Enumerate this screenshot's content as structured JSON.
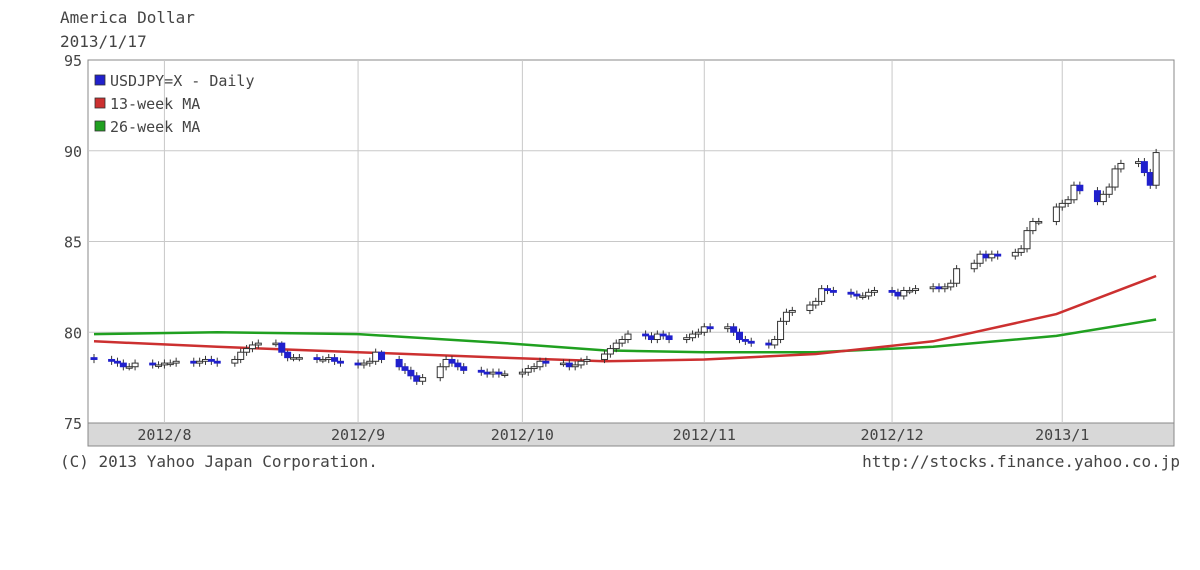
{
  "header": {
    "title": "America Dollar",
    "date": "2013/1/17"
  },
  "footer": {
    "copyright": "(C) 2013 Yahoo Japan Corporation.",
    "url": "http://stocks.finance.yahoo.co.jp"
  },
  "colors": {
    "up_candle": "#ffffff",
    "down_candle": "#2020cc",
    "ma13": "#cc3030",
    "ma26": "#20a020",
    "grid": "#c8c8c8",
    "axis_band": "#d8d8d8"
  },
  "chart_data": {
    "type": "candlestick",
    "title": "America Dollar",
    "subtitle": "2013/1/17",
    "ylim": [
      75,
      95
    ],
    "y_ticks": [
      75,
      80,
      85,
      90,
      95
    ],
    "x_tick_labels": [
      "2012/8",
      "2012/9",
      "2012/10",
      "2012/11",
      "2012/12",
      "2013/1"
    ],
    "x_tick_dates": [
      "2012-08-01",
      "2012-09-03",
      "2012-10-01",
      "2012-11-01",
      "2012-12-03",
      "2013-01-01"
    ],
    "x_range": [
      "2012-07-20",
      "2013-01-18"
    ],
    "grid": true,
    "legend_position": "top-left",
    "legend": [
      {
        "label": "USDJPY=X - Daily",
        "color": "#2020cc"
      },
      {
        "label": "13-week MA",
        "color": "#cc3030"
      },
      {
        "label": "26-week MA",
        "color": "#20a020"
      }
    ],
    "series": [
      {
        "name": "USDJPY=X - Daily",
        "dates": [
          "2012-07-20",
          "2012-07-23",
          "2012-07-24",
          "2012-07-25",
          "2012-07-26",
          "2012-07-27",
          "2012-07-30",
          "2012-07-31",
          "2012-08-01",
          "2012-08-02",
          "2012-08-03",
          "2012-08-06",
          "2012-08-07",
          "2012-08-08",
          "2012-08-09",
          "2012-08-10",
          "2012-08-13",
          "2012-08-14",
          "2012-08-15",
          "2012-08-16",
          "2012-08-17",
          "2012-08-20",
          "2012-08-21",
          "2012-08-22",
          "2012-08-23",
          "2012-08-24",
          "2012-08-27",
          "2012-08-28",
          "2012-08-29",
          "2012-08-30",
          "2012-08-31",
          "2012-09-03",
          "2012-09-04",
          "2012-09-05",
          "2012-09-06",
          "2012-09-07",
          "2012-09-10",
          "2012-09-11",
          "2012-09-12",
          "2012-09-13",
          "2012-09-14",
          "2012-09-17",
          "2012-09-18",
          "2012-09-19",
          "2012-09-20",
          "2012-09-21",
          "2012-09-24",
          "2012-09-25",
          "2012-09-26",
          "2012-09-27",
          "2012-09-28",
          "2012-10-01",
          "2012-10-02",
          "2012-10-03",
          "2012-10-04",
          "2012-10-05",
          "2012-10-08",
          "2012-10-09",
          "2012-10-10",
          "2012-10-11",
          "2012-10-12",
          "2012-10-15",
          "2012-10-16",
          "2012-10-17",
          "2012-10-18",
          "2012-10-19",
          "2012-10-22",
          "2012-10-23",
          "2012-10-24",
          "2012-10-25",
          "2012-10-26",
          "2012-10-29",
          "2012-10-30",
          "2012-10-31",
          "2012-11-01",
          "2012-11-02",
          "2012-11-05",
          "2012-11-06",
          "2012-11-07",
          "2012-11-08",
          "2012-11-09",
          "2012-11-12",
          "2012-11-13",
          "2012-11-14",
          "2012-11-15",
          "2012-11-16",
          "2012-11-19",
          "2012-11-20",
          "2012-11-21",
          "2012-11-22",
          "2012-11-23",
          "2012-11-26",
          "2012-11-27",
          "2012-11-28",
          "2012-11-29",
          "2012-11-30",
          "2012-12-03",
          "2012-12-04",
          "2012-12-05",
          "2012-12-06",
          "2012-12-07",
          "2012-12-10",
          "2012-12-11",
          "2012-12-12",
          "2012-12-13",
          "2012-12-14",
          "2012-12-17",
          "2012-12-18",
          "2012-12-19",
          "2012-12-20",
          "2012-12-21",
          "2012-12-24",
          "2012-12-25",
          "2012-12-26",
          "2012-12-27",
          "2012-12-28",
          "2012-12-31",
          "2013-01-01",
          "2013-01-02",
          "2013-01-03",
          "2013-01-04",
          "2013-01-07",
          "2013-01-08",
          "2013-01-09",
          "2013-01-10",
          "2013-01-11",
          "2013-01-14",
          "2013-01-15",
          "2013-01-16",
          "2013-01-17"
        ],
        "open": [
          78.6,
          78.5,
          78.4,
          78.3,
          78.1,
          78.1,
          78.3,
          78.2,
          78.2,
          78.3,
          78.3,
          78.4,
          78.3,
          78.4,
          78.5,
          78.4,
          78.3,
          78.5,
          78.9,
          79.1,
          79.3,
          79.4,
          79.4,
          78.9,
          78.6,
          78.6,
          78.6,
          78.5,
          78.5,
          78.6,
          78.4,
          78.3,
          78.2,
          78.3,
          78.4,
          78.9,
          78.5,
          78.1,
          77.9,
          77.6,
          77.3,
          77.5,
          78.1,
          78.5,
          78.3,
          78.1,
          77.9,
          77.8,
          77.7,
          77.8,
          77.7,
          77.7,
          77.8,
          78.0,
          78.1,
          78.4,
          78.3,
          78.3,
          78.1,
          78.2,
          78.4,
          78.5,
          78.8,
          79.1,
          79.4,
          79.6,
          79.9,
          79.8,
          79.6,
          79.9,
          79.8,
          79.6,
          79.7,
          79.9,
          80.0,
          80.3,
          80.2,
          80.3,
          80.0,
          79.6,
          79.5,
          79.4,
          79.3,
          79.6,
          80.6,
          81.1,
          81.2,
          81.5,
          81.7,
          82.4,
          82.3,
          82.2,
          82.1,
          82.0,
          82.0,
          82.2,
          82.3,
          82.2,
          82.0,
          82.3,
          82.3,
          82.4,
          82.5,
          82.4,
          82.5,
          82.7,
          83.5,
          83.8,
          84.3,
          84.1,
          84.3,
          84.2,
          84.4,
          84.6,
          85.6,
          86.1,
          86.1,
          86.9,
          87.1,
          87.3,
          88.1,
          87.8,
          87.2,
          87.6,
          88.0,
          89.0,
          89.3,
          89.4,
          88.8,
          88.1
        ],
        "close": [
          78.5,
          78.4,
          78.3,
          78.1,
          78.1,
          78.3,
          78.2,
          78.2,
          78.3,
          78.3,
          78.4,
          78.3,
          78.4,
          78.5,
          78.4,
          78.3,
          78.5,
          78.9,
          79.1,
          79.3,
          79.4,
          79.4,
          78.9,
          78.6,
          78.6,
          78.6,
          78.5,
          78.5,
          78.6,
          78.4,
          78.3,
          78.2,
          78.3,
          78.4,
          78.9,
          78.5,
          78.1,
          77.9,
          77.6,
          77.3,
          77.5,
          78.1,
          78.5,
          78.3,
          78.1,
          77.9,
          77.8,
          77.7,
          77.8,
          77.7,
          77.7,
          77.8,
          78.0,
          78.1,
          78.4,
          78.3,
          78.3,
          78.1,
          78.2,
          78.4,
          78.5,
          78.8,
          79.1,
          79.4,
          79.6,
          79.9,
          79.8,
          79.6,
          79.9,
          79.8,
          79.6,
          79.7,
          79.9,
          80.0,
          80.3,
          80.2,
          80.3,
          80.0,
          79.6,
          79.5,
          79.4,
          79.3,
          79.6,
          80.6,
          81.1,
          81.2,
          81.5,
          81.7,
          82.4,
          82.3,
          82.2,
          82.1,
          82.0,
          82.0,
          82.2,
          82.3,
          82.2,
          82.0,
          82.3,
          82.3,
          82.4,
          82.5,
          82.4,
          82.5,
          82.7,
          83.5,
          83.8,
          84.3,
          84.1,
          84.3,
          84.2,
          84.4,
          84.6,
          85.6,
          86.1,
          86.1,
          86.9,
          87.1,
          87.3,
          88.1,
          87.8,
          87.2,
          87.6,
          88.0,
          89.0,
          89.3,
          89.4,
          88.8,
          88.1,
          89.9
        ],
        "high": [
          78.8,
          78.7,
          78.6,
          78.5,
          78.3,
          78.5,
          78.5,
          78.4,
          78.5,
          78.5,
          78.6,
          78.6,
          78.6,
          78.7,
          78.7,
          78.6,
          78.7,
          79.1,
          79.3,
          79.5,
          79.6,
          79.6,
          79.5,
          79.0,
          78.8,
          78.8,
          78.8,
          78.7,
          78.8,
          78.8,
          78.6,
          78.5,
          78.5,
          78.6,
          79.1,
          79.0,
          78.7,
          78.3,
          78.1,
          77.8,
          77.7,
          78.3,
          78.7,
          78.7,
          78.5,
          78.3,
          78.1,
          78.0,
          78.0,
          78.0,
          77.9,
          78.0,
          78.2,
          78.3,
          78.6,
          78.6,
          78.5,
          78.5,
          78.4,
          78.6,
          78.7,
          79.0,
          79.3,
          79.6,
          79.8,
          80.1,
          80.1,
          80.0,
          80.1,
          80.1,
          80.0,
          79.9,
          80.1,
          80.2,
          80.5,
          80.5,
          80.5,
          80.5,
          80.2,
          79.8,
          79.7,
          79.6,
          79.8,
          80.8,
          81.3,
          81.4,
          81.7,
          81.9,
          82.6,
          82.6,
          82.5,
          82.4,
          82.3,
          82.2,
          82.4,
          82.5,
          82.5,
          82.4,
          82.5,
          82.5,
          82.6,
          82.7,
          82.7,
          82.7,
          82.9,
          83.7,
          84.0,
          84.5,
          84.5,
          84.5,
          84.5,
          84.6,
          84.8,
          85.8,
          86.3,
          86.3,
          87.1,
          87.3,
          87.5,
          88.3,
          88.3,
          88.0,
          87.8,
          88.2,
          89.2,
          89.5,
          89.6,
          89.6,
          89.0,
          90.1
        ],
        "low": [
          78.3,
          78.2,
          78.1,
          77.9,
          77.9,
          77.9,
          78.0,
          78.0,
          78.0,
          78.1,
          78.1,
          78.1,
          78.1,
          78.2,
          78.2,
          78.1,
          78.1,
          78.3,
          78.7,
          78.9,
          79.1,
          79.2,
          78.7,
          78.4,
          78.4,
          78.4,
          78.3,
          78.3,
          78.3,
          78.2,
          78.1,
          78.0,
          78.0,
          78.1,
          78.2,
          78.3,
          77.9,
          77.7,
          77.4,
          77.1,
          77.1,
          77.3,
          77.9,
          78.1,
          77.9,
          77.7,
          77.6,
          77.5,
          77.5,
          77.5,
          77.5,
          77.5,
          77.6,
          77.8,
          77.9,
          78.1,
          78.1,
          77.9,
          77.9,
          78.0,
          78.2,
          78.3,
          78.6,
          78.9,
          79.2,
          79.4,
          79.6,
          79.4,
          79.4,
          79.6,
          79.4,
          79.4,
          79.5,
          79.7,
          79.8,
          80.0,
          80.0,
          79.8,
          79.4,
          79.3,
          79.2,
          79.1,
          79.1,
          79.4,
          80.4,
          80.9,
          81.0,
          81.3,
          81.5,
          82.1,
          82.0,
          81.9,
          81.8,
          81.8,
          81.8,
          82.0,
          82.0,
          81.8,
          81.8,
          82.1,
          82.1,
          82.2,
          82.2,
          82.2,
          82.3,
          82.5,
          83.3,
          83.6,
          83.9,
          83.9,
          84.0,
          84.0,
          84.2,
          84.4,
          85.4,
          85.9,
          85.9,
          86.7,
          86.9,
          87.1,
          87.6,
          87.0,
          87.0,
          87.4,
          87.8,
          88.8,
          89.1,
          88.6,
          87.9,
          87.9
        ]
      },
      {
        "name": "13-week MA",
        "dates": [
          "2012-07-20",
          "2012-08-10",
          "2012-09-03",
          "2012-09-28",
          "2012-10-15",
          "2012-11-01",
          "2012-11-20",
          "2012-12-10",
          "2012-12-31",
          "2013-01-17"
        ],
        "values": [
          79.5,
          79.2,
          78.9,
          78.6,
          78.4,
          78.5,
          78.8,
          79.5,
          81.0,
          83.1
        ]
      },
      {
        "name": "26-week MA",
        "dates": [
          "2012-07-20",
          "2012-08-10",
          "2012-09-03",
          "2012-09-28",
          "2012-10-15",
          "2012-11-01",
          "2012-11-20",
          "2012-12-10",
          "2012-12-31",
          "2013-01-17"
        ],
        "values": [
          79.9,
          80.0,
          79.9,
          79.4,
          79.0,
          78.9,
          78.9,
          79.2,
          79.8,
          80.7
        ]
      }
    ]
  }
}
